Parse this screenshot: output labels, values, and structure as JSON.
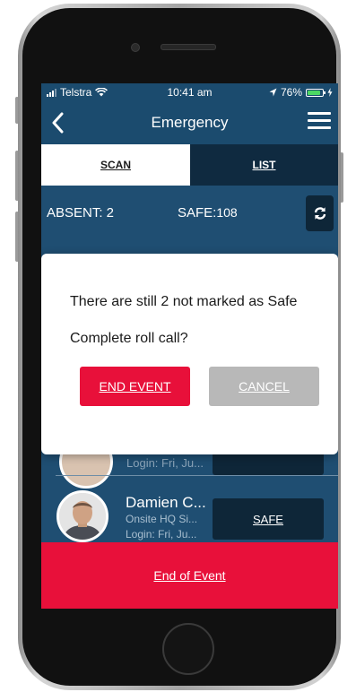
{
  "status_bar": {
    "carrier": "Telstra",
    "time": "10:41 am",
    "battery": "76%",
    "icons": [
      "signal-icon",
      "wifi-icon",
      "location-icon",
      "battery-icon",
      "charging-icon"
    ]
  },
  "nav": {
    "title": "Emergency",
    "back_icon": "chevron-left-icon",
    "menu_icon": "hamburger-menu-icon"
  },
  "tabs": [
    {
      "label": "SCAN",
      "active": true
    },
    {
      "label": "LIST",
      "active": false
    }
  ],
  "counts": {
    "absent_label": "ABSENT: 2",
    "safe_label": "SAFE:",
    "safe_value": "108",
    "refresh_icon": "refresh-icon"
  },
  "list": {
    "partial_login": "Login: Fri, Ju...",
    "person": {
      "name": "Damien C...",
      "location": "Onsite HQ Si...",
      "login": "Login: Fri, Ju...",
      "safe_button": "SAFE"
    }
  },
  "dialog": {
    "message": "There are still 2 not marked as Safe",
    "question": "Complete roll call?",
    "end_button": "END EVENT",
    "cancel_button": "CANCEL"
  },
  "footer": {
    "end_label": "End of Event"
  },
  "colors": {
    "navy": "#1b4b6e",
    "dark_navy": "#0e2638",
    "red": "#e8103a",
    "grey_button": "#b8b8b8"
  }
}
